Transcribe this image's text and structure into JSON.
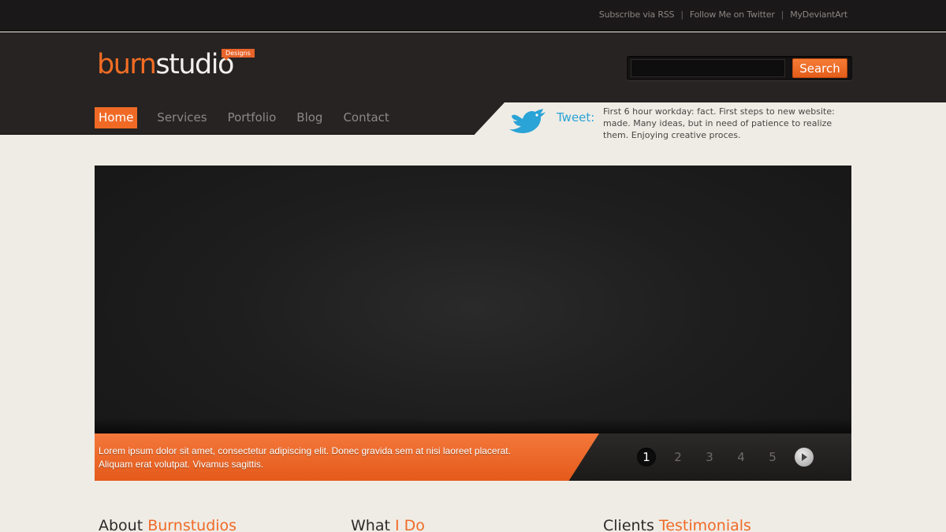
{
  "topbar": {
    "links": [
      "Subscribe via RSS",
      "Follow Me  on Twitter",
      "MyDeviantArt"
    ],
    "separator": "|"
  },
  "logo": {
    "part1": "burn",
    "part2": "studio",
    "badge": "Designs"
  },
  "search": {
    "value": "",
    "placeholder": "",
    "button_label": "Search"
  },
  "nav": {
    "items": [
      "Home",
      "Services",
      "Portfolio",
      "Blog",
      "Contact"
    ],
    "active": "Home"
  },
  "tweet": {
    "label": "Tweet:",
    "text": "First 6 hour workday: fact. First steps to new website: made. Many ideas, but in need of patience to realize them. Enjoying creative proces."
  },
  "slider": {
    "caption": "Lorem ipsum dolor sit amet, consectetur adipiscing elit. Donec gravida sem at nisi laoreet placerat. Aliquam erat volutpat. Vivamus sagittis.",
    "pages": [
      "1",
      "2",
      "3",
      "4",
      "5"
    ],
    "active_page": "1"
  },
  "sections": [
    {
      "title": "About",
      "highlight": "Burnstudios"
    },
    {
      "title": "What",
      "highlight": "I Do"
    },
    {
      "title": "Clients",
      "highlight": "Testimonials"
    }
  ],
  "colors": {
    "accent": "#f06a26",
    "dark": "#262322",
    "twitter": "#2aa3d6",
    "background": "#efece6"
  }
}
